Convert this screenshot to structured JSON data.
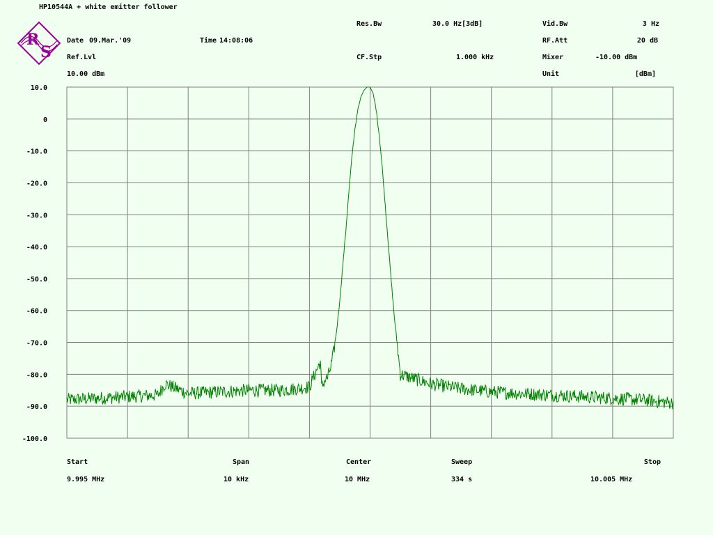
{
  "header": {
    "title": "HP10544A + white emitter follower",
    "date_label": "Date",
    "date_value": "09.Mar.'09",
    "time_label": "Time",
    "time_value": "14:08:06",
    "ref_lvl_label": "Ref.Lvl",
    "ref_lvl_value": "10.00 dBm",
    "res_bw_label": "Res.Bw",
    "res_bw_value": "30.0 Hz[3dB]",
    "cf_stp_label": "CF.Stp",
    "cf_stp_value": "1.000 kHz",
    "vid_bw_label": "Vid.Bw",
    "vid_bw_value": "3 Hz",
    "rf_att_label": "RF.Att",
    "rf_att_value": "20 dB",
    "mixer_label": "Mixer",
    "mixer_value": "-10.00 dBm",
    "unit_label": "Unit",
    "unit_value": "[dBm]",
    "logo_text": "R&S"
  },
  "footer": {
    "start_label": "Start",
    "start_value": "9.995 MHz",
    "span_label": "Span",
    "span_value": "10 kHz",
    "center_label": "Center",
    "center_value": "10 MHz",
    "sweep_label": "Sweep",
    "sweep_value": "334 s",
    "stop_label": "Stop",
    "stop_value": "10.005 MHz"
  },
  "colors": {
    "background": "#f0fff0",
    "grid": "#808080",
    "trace": "#008000",
    "logo": "#990099",
    "text": "#000000"
  },
  "chart_data": {
    "type": "line",
    "title": "HP10544A + white emitter follower",
    "xlabel": "",
    "ylabel": "",
    "x_unit": "MHz",
    "xlim": [
      9.995,
      10.005
    ],
    "ylim": [
      -100,
      10
    ],
    "grid": true,
    "ytick_labels": [
      "10.0",
      "0",
      "-10.0",
      "-20.0",
      "-30.0",
      "-40.0",
      "-50.0",
      "-60.0",
      "-70.0",
      "-80.0",
      "-90.0",
      "-100.0"
    ],
    "ytick_values": [
      10,
      0,
      -10,
      -20,
      -30,
      -40,
      -50,
      -60,
      -70,
      -80,
      -90,
      -100
    ],
    "x_divisions": 10,
    "series": [
      {
        "color": "#008000",
        "x": [
          9.995,
          9.9955,
          9.996,
          9.9965,
          9.99662,
          9.997,
          9.9975,
          9.998,
          9.9985,
          9.9988,
          9.99895,
          9.999,
          9.99918,
          9.9992,
          9.99925,
          9.9993,
          9.99935,
          9.9994,
          9.99945,
          9.9995,
          9.99955,
          9.9996,
          9.99965,
          9.9997,
          9.99975,
          9.9998,
          9.99985,
          9.9999,
          9.99995,
          10.0,
          10.00005,
          10.0001,
          10.00015,
          10.0002,
          10.00025,
          10.0003,
          10.00035,
          10.0004,
          10.0005,
          10.001,
          10.0015,
          10.002,
          10.0025,
          10.003,
          10.0035,
          10.004,
          10.0045,
          10.005
        ],
        "y": [
          -88,
          -87.5,
          -87,
          -86.5,
          -83,
          -86,
          -85.5,
          -85,
          -85,
          -84.5,
          -84,
          -84,
          -76,
          -84,
          -82,
          -81,
          -78,
          -73,
          -66,
          -57,
          -46,
          -35,
          -23,
          -12,
          -3,
          3,
          7,
          9,
          10,
          10,
          8,
          3,
          -5,
          -15,
          -27,
          -39,
          -51,
          -62,
          -80,
          -83,
          -84.5,
          -85.5,
          -86,
          -86.5,
          -87,
          -87.5,
          -88,
          -89
        ]
      }
    ]
  }
}
